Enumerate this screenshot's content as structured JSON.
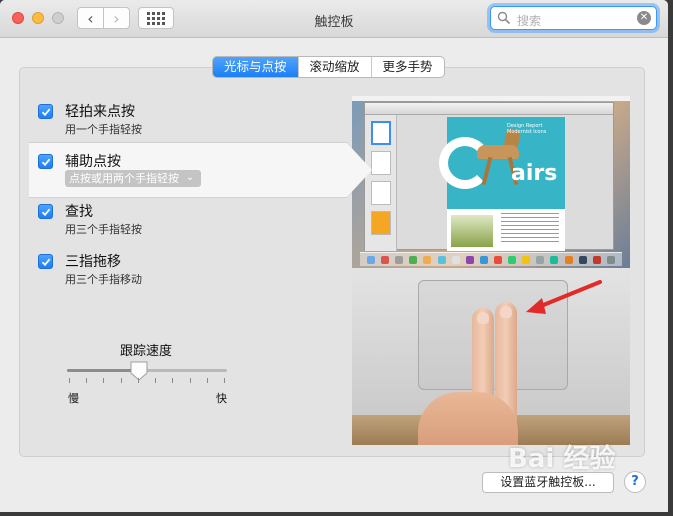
{
  "window": {
    "title": "触控板"
  },
  "search": {
    "placeholder": "搜索"
  },
  "tabs": [
    {
      "label": "光标与点按",
      "active": true
    },
    {
      "label": "滚动缩放",
      "active": false
    },
    {
      "label": "更多手势",
      "active": false
    }
  ],
  "options": [
    {
      "title": "轻拍来点按",
      "subtitle": "用一个手指轻按",
      "checked": true
    },
    {
      "title": "辅助点按",
      "popup_value": "点按或用两个手指轻按",
      "checked": true,
      "selected": true
    },
    {
      "title": "查找",
      "subtitle": "用三个手指轻按",
      "checked": true
    },
    {
      "title": "三指拖移",
      "subtitle": "用三个手指移动",
      "checked": true
    }
  ],
  "tracking": {
    "label": "跟踪速度",
    "min_label": "慢",
    "max_label": "快",
    "value_fraction": 0.45,
    "tick_count": 10
  },
  "preview": {
    "doc_title": "Design Report Modernist Icons",
    "doc_word": "airs"
  },
  "footer": {
    "bluetooth_button": "设置蓝牙触控板...",
    "help_label": "?"
  },
  "watermark": {
    "text": "Bai 经验"
  },
  "colors": {
    "accent": "#1d7ff5",
    "arrow": "#e22a2a"
  }
}
